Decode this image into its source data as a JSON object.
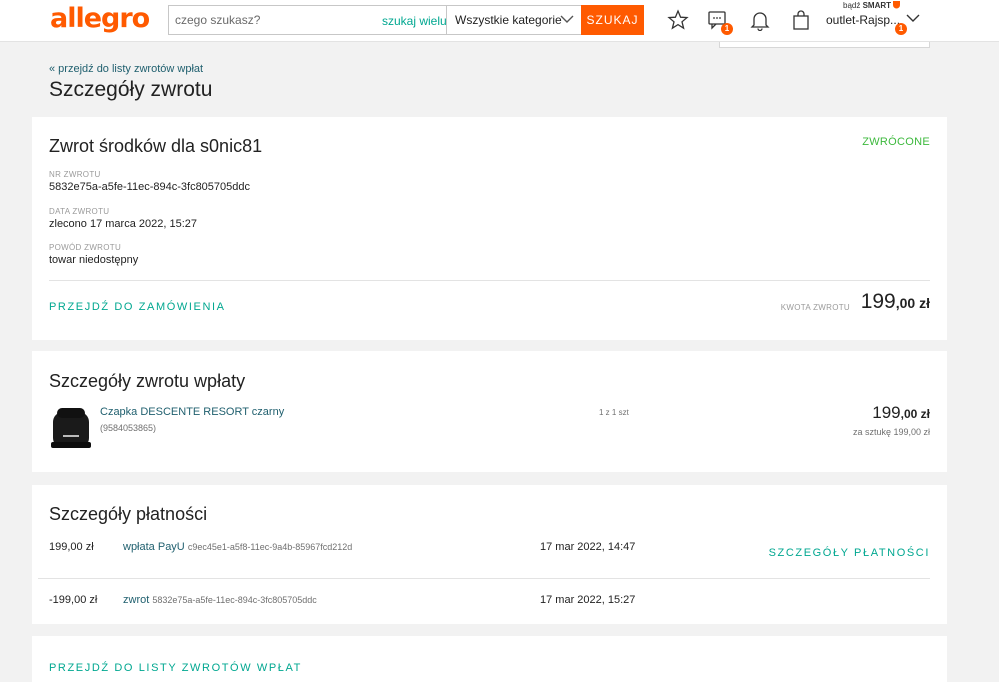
{
  "header": {
    "logo": "allegro",
    "search_placeholder": "czego szukasz?",
    "search_many": "szukaj wielu",
    "category": "Wszystkie kategorie",
    "search_button": "SZUKAJ",
    "messages_badge": "1",
    "smart_prefix": "bądź",
    "smart_label": "SMART",
    "user_name": "outlet-Rajsp...",
    "user_badge": "1",
    "accent": "#ff5a00"
  },
  "page": {
    "back_link": "« przejdź do listy zwrotów wpłat",
    "title": "Szczegóły zwrotu"
  },
  "refund": {
    "title": "Zwrot środków dla s0nic81",
    "status": "ZWRÓCONE",
    "nr_label": "NR ZWROTU",
    "nr_value": "5832e75a-a5fe-11ec-894c-3fc805705ddc",
    "date_label": "DATA ZWROTU",
    "date_value": "zlecono 17 marca 2022, 15:27",
    "reason_label": "POWÓD ZWROTU",
    "reason_value": "towar niedostępny",
    "order_link": "PRZEJDŹ DO ZAMÓWIENIA",
    "amount_label": "KWOTA ZWROTU",
    "amount_main": "199",
    "amount_cents": ",00 zł"
  },
  "payment_refund": {
    "title": "Szczegóły zwrotu wpłaty",
    "product_name": "Czapka DESCENTE RESORT czarny",
    "product_id": "(9584053865)",
    "quantity": "1 z 1 szt",
    "price_main": "199",
    "price_cents": ",00 zł",
    "per_unit": "za sztukę 199,00 zł"
  },
  "payments": {
    "title": "Szczegóły płatności",
    "details_link": "SZCZEGÓŁY PŁATNOŚCI",
    "rows": [
      {
        "amount": "199,00 zł",
        "type": "wpłata PayU",
        "id": "c9ec45e1-a5f8-11ec-9a4b-85967fcd212d",
        "date": "17 mar 2022, 14:47"
      },
      {
        "amount": "-199,00 zł",
        "type": "zwrot",
        "id": "5832e75a-a5fe-11ec-894c-3fc805705ddc",
        "date": "17 mar 2022, 15:27"
      }
    ]
  },
  "footer_link": "PRZEJDŹ DO LISTY ZWROTÓW WPŁAT"
}
